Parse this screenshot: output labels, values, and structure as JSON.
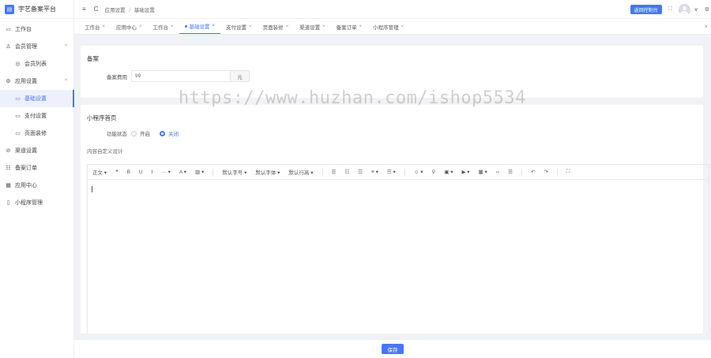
{
  "sidebar": {
    "logo_text": "宇艺备案平台",
    "logo_icon": "box-icon",
    "items": [
      {
        "label": "工作台",
        "icon": "monitor-icon"
      },
      {
        "label": "会员管理",
        "icon": "user-icon",
        "arrow": "^"
      },
      {
        "label": "会员列表",
        "icon": "circle-icon"
      },
      {
        "label": "应用设置",
        "icon": "gear-icon",
        "arrow": "^"
      },
      {
        "label": "基础设置",
        "icon": "window-icon"
      },
      {
        "label": "支付设置",
        "icon": "window-icon"
      },
      {
        "label": "页面装修",
        "icon": "window-icon"
      },
      {
        "label": "渠道设置",
        "icon": "compass-icon"
      },
      {
        "label": "备案订单",
        "icon": "list-icon"
      },
      {
        "label": "应用中心",
        "icon": "grid-icon"
      },
      {
        "label": "小程序管理",
        "icon": "phone-icon"
      }
    ]
  },
  "header": {
    "menu_icon": "≡",
    "refresh_icon": "C",
    "breadcrumb": [
      "应用设置",
      "基础设置"
    ],
    "breadcrumb_sep": "/",
    "back_button": "返回控制台",
    "fullscreen_icon": "⛶",
    "chevron": "∨",
    "settings_icon": "⚙"
  },
  "tabs": [
    {
      "label": "工作台",
      "close": "×"
    },
    {
      "label": "应用中心",
      "close": "×"
    },
    {
      "label": "工作台",
      "close": "×"
    },
    {
      "label": "基础设置",
      "close": "×",
      "active": true
    },
    {
      "label": "支付设置",
      "close": "×"
    },
    {
      "label": "页面装修",
      "close": "×"
    },
    {
      "label": "渠道设置",
      "close": "×"
    },
    {
      "label": "备案订单",
      "close": "×"
    },
    {
      "label": "小程序管理",
      "close": "×"
    }
  ],
  "tabs_more": "∨",
  "section1": {
    "title": "备案",
    "fee_label": "备案费用",
    "fee_value": "99",
    "fee_unit": "元"
  },
  "section2": {
    "title": "小程序首页",
    "status_label": "功能状态",
    "option_on": "开启",
    "option_off": "关闭",
    "selected": "关闭",
    "custom_label": "内容自定义设计"
  },
  "editor": {
    "toolbar": [
      "正文 ▾",
      "❝",
      "B",
      "U",
      "I",
      "··· ▾",
      "A ▾",
      "▨ ▾",
      "|",
      "默认字号 ▾",
      "默认字体 ▾",
      "默认行高 ▾",
      "|",
      "☰",
      "☷",
      "☲",
      "≡ ▾",
      "☴ ▾",
      "|",
      "☺ ▾",
      "⚲",
      "▣ ▾",
      "▶ ▾",
      "▦ ▾",
      "‹›",
      "☰",
      "|",
      "↶",
      "↷",
      "|",
      "⛶"
    ]
  },
  "footer": {
    "save_button": "保存"
  },
  "watermark": "https://www.huzhan.com/ishop5534",
  "colors": {
    "accent": "#4876f0",
    "background": "#f0f2f5"
  }
}
